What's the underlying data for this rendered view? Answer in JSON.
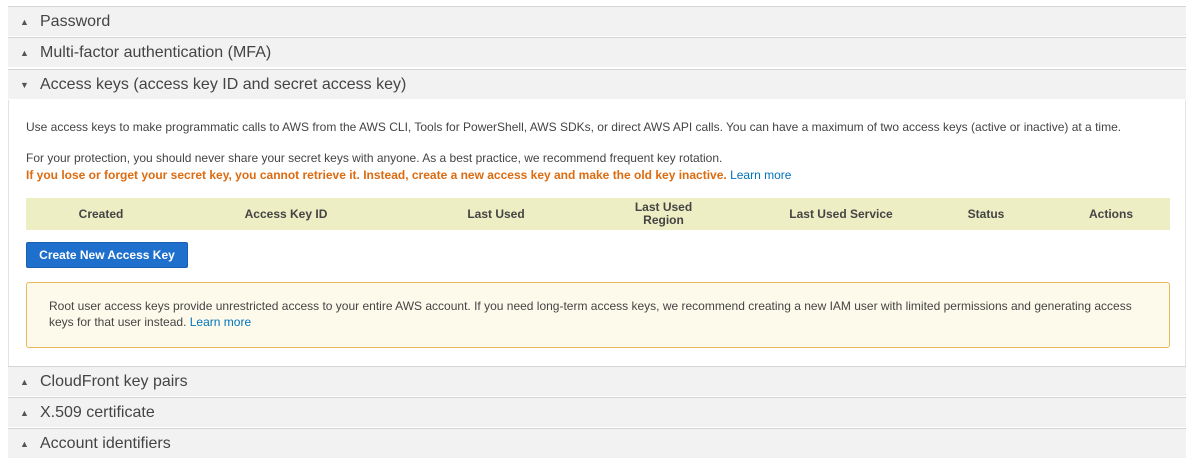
{
  "sections_top": [
    {
      "label": "Password",
      "name": "section-password"
    },
    {
      "label": "Multi-factor authentication (MFA)",
      "name": "section-mfa"
    },
    {
      "label": "Access keys (access key ID and secret access key)",
      "name": "section-access-keys"
    }
  ],
  "sections_bottom": [
    {
      "label": "CloudFront key pairs",
      "name": "section-cloudfront-key-pairs"
    },
    {
      "label": "X.509 certificate",
      "name": "section-x509-certificate"
    },
    {
      "label": "Account identifiers",
      "name": "section-account-identifiers"
    }
  ],
  "access_keys": {
    "intro": "Use access keys to make programmatic calls to AWS from the AWS CLI, Tools for PowerShell, AWS SDKs, or direct AWS API calls. You can have a maximum of two access keys (active or inactive) at a time.",
    "protection": "For your protection, you should never share your secret keys with anyone. As a best practice, we recommend frequent key rotation.",
    "warning": "If you lose or forget your secret key, you cannot retrieve it. Instead, create a new access key and make the old key inactive.",
    "learn_more": "Learn more",
    "columns": [
      "Created",
      "Access Key ID",
      "Last Used",
      "Last Used Region",
      "Last Used Service",
      "Status",
      "Actions"
    ],
    "create_button": "Create New Access Key",
    "notice": "Root user access keys provide unrestricted access to your entire AWS account. If you need long-term access keys, we recommend creating a new IAM user with limited permissions and generating access keys for that user instead.",
    "notice_learn_more": "Learn more"
  },
  "icons": {
    "collapsed": "triangle-up-icon",
    "expanded": "triangle-down-icon"
  },
  "colors": {
    "warning": "#dd6b10",
    "link": "#0073bb",
    "button": "#1f6fcc",
    "table_header": "#eeeec4"
  }
}
